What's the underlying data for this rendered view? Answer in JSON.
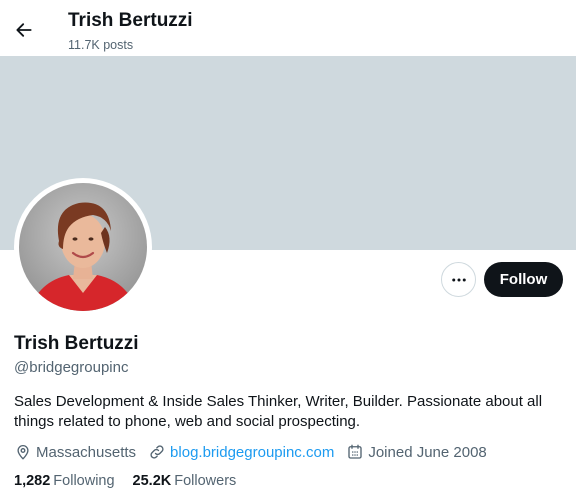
{
  "header": {
    "title": "Trish Bertuzzi",
    "posts_count": "11.7K posts"
  },
  "profile": {
    "name": "Trish Bertuzzi",
    "handle": "@bridgegroupinc",
    "bio": "Sales Development & Inside Sales Thinker, Writer, Builder. Passionate about all things related to phone, web and social prospecting.",
    "location": "Massachusetts",
    "website": "blog.bridgegroupinc.com",
    "joined": "Joined June 2008",
    "following_count": "1,282",
    "following_label": "Following",
    "followers_count": "25.2K",
    "followers_label": "Followers"
  },
  "actions": {
    "follow_label": "Follow"
  },
  "icons": {
    "back": "arrow-left-icon",
    "more": "more-horizontal-icon",
    "location": "location-pin-icon",
    "link": "link-icon",
    "calendar": "calendar-icon"
  },
  "colors": {
    "banner": "#cfd9de",
    "follow_button": "#0f1419",
    "link": "#1d9bf0",
    "secondary_text": "#536471"
  }
}
